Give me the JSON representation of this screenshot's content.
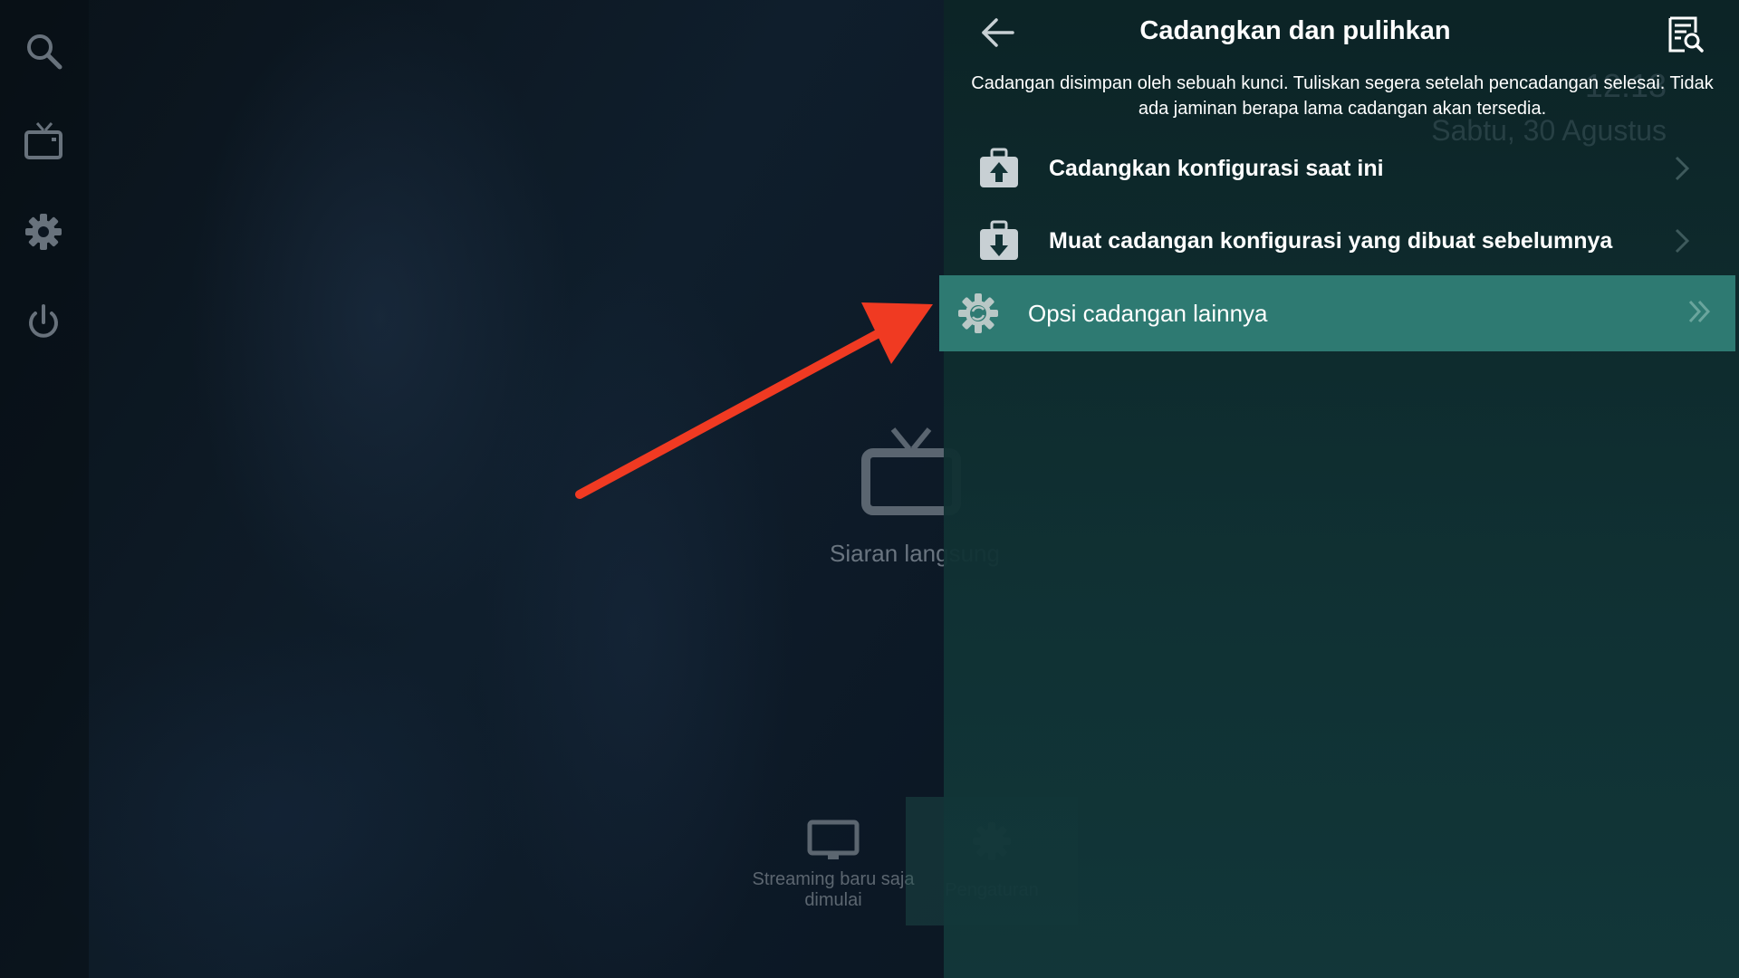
{
  "left_rail": {
    "icons": [
      "search-icon",
      "tv-icon",
      "gear-icon",
      "power-icon"
    ]
  },
  "home": {
    "live_label": "Siaran langsung",
    "tiles": [
      {
        "label": "Streaming baru saja dimulai",
        "icon": "monitor-icon"
      },
      {
        "label": "Pengaturan",
        "icon": "gear-icon"
      }
    ]
  },
  "panel_behind": {
    "clock": "12:13",
    "date": "Sabtu, 30 Agustus"
  },
  "panel": {
    "title": "Cadangkan dan pulihkan",
    "description": "Cadangan disimpan oleh sebuah kunci. Tuliskan segera setelah pencadangan selesai. Tidak ada jaminan berapa lama cadangan akan tersedia.",
    "items": [
      {
        "label": "Cadangkan konfigurasi saat ini",
        "icon": "briefcase-upload-icon"
      },
      {
        "label": "Muat cadangan konfigurasi yang dibuat sebelumnya",
        "icon": "briefcase-download-icon"
      },
      {
        "label": "Opsi cadangan lainnya",
        "icon": "gear-sync-icon",
        "selected": true
      }
    ]
  },
  "colors": {
    "accent": "#2e7a72",
    "arrow": "#f03a22"
  }
}
